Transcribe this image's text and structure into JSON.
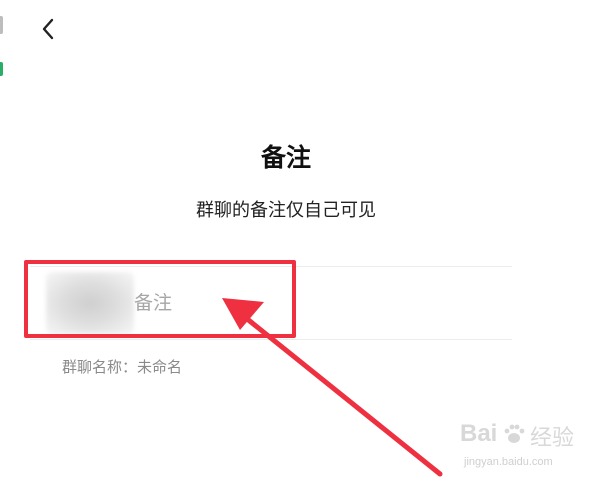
{
  "header": {
    "back_icon": "chevron-left-icon"
  },
  "page": {
    "title": "备注",
    "subtitle": "群聊的备注仅自己可见"
  },
  "remark_field": {
    "placeholder": "备注",
    "value": ""
  },
  "group_info": {
    "label": "群聊名称：未命名"
  },
  "annotation": {
    "box_color": "#ee3040",
    "arrow_color": "#ee3040"
  },
  "watermark": {
    "brand_left": "Bai",
    "brand_right": "经验",
    "url": "jingyan.baidu.com"
  },
  "colors": {
    "accent_green": "#2aae67",
    "text_primary": "#111111",
    "text_secondary": "#8a8a8a",
    "placeholder": "#a6a6a6"
  }
}
